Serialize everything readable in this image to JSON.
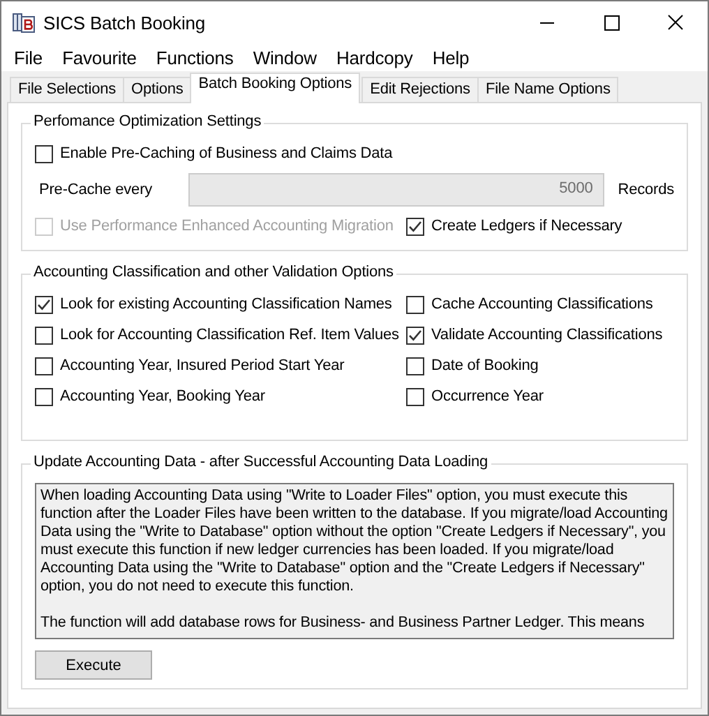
{
  "window": {
    "title": "SICS Batch Booking"
  },
  "menu": [
    "File",
    "Favourite",
    "Functions",
    "Window",
    "Hardcopy",
    "Help"
  ],
  "tabs": [
    {
      "label": "File Selections",
      "selected": false
    },
    {
      "label": "Options",
      "selected": false
    },
    {
      "label": "Batch Booking Options",
      "selected": true
    },
    {
      "label": "Edit Rejections",
      "selected": false
    },
    {
      "label": "File Name Options",
      "selected": false
    }
  ],
  "performance": {
    "title": "Perfomance Optimization Settings",
    "precache": {
      "label": "Enable Pre-Caching of Business and Claims Data",
      "checked": false,
      "disabled": false
    },
    "interval": {
      "label": "Pre-Cache every",
      "value": "5000",
      "unit": "Records",
      "disabled": true
    },
    "options": [
      {
        "label": "Use Performance Enhanced Accounting Migration",
        "checked": false,
        "disabled": true
      },
      {
        "label": "Create Ledgers if Necessary",
        "checked": true,
        "disabled": false
      }
    ]
  },
  "validation": {
    "title": "Accounting Classification and other Validation Options",
    "options": [
      {
        "label": "Look for existing Accounting Classification Names",
        "checked": true
      },
      {
        "label": "Cache Accounting Classifications",
        "checked": false
      },
      {
        "label": "Look for Accounting Classification Ref. Item Values",
        "checked": false
      },
      {
        "label": "Validate Accounting Classifications",
        "checked": true
      },
      {
        "label": "Accounting Year, Insured Period Start Year",
        "checked": false
      },
      {
        "label": "Date of Booking",
        "checked": false
      },
      {
        "label": "Accounting Year, Booking Year",
        "checked": false
      },
      {
        "label": "Occurrence Year",
        "checked": false
      }
    ]
  },
  "update": {
    "title": "Update Accounting Data - after Successful Accounting Data Loading",
    "description": [
      "When loading Accounting Data using \"Write to Loader Files\" option, you must execute this function after the Loader Files have been written to the database. If you migrate/load Accounting Data using the \"Write to Database\" option without the option \"Create Ledgers if Necessary\", you must execute this function if new ledger currencies has been loaded. If you migrate/load Accounting Data using the \"Write to Database\" option and the \"Create Ledgers if Necessary\" option, you do not need to execute this function.",
      "The function will add database rows for Business- and Business Partner Ledger. This means"
    ],
    "button": "Execute"
  }
}
